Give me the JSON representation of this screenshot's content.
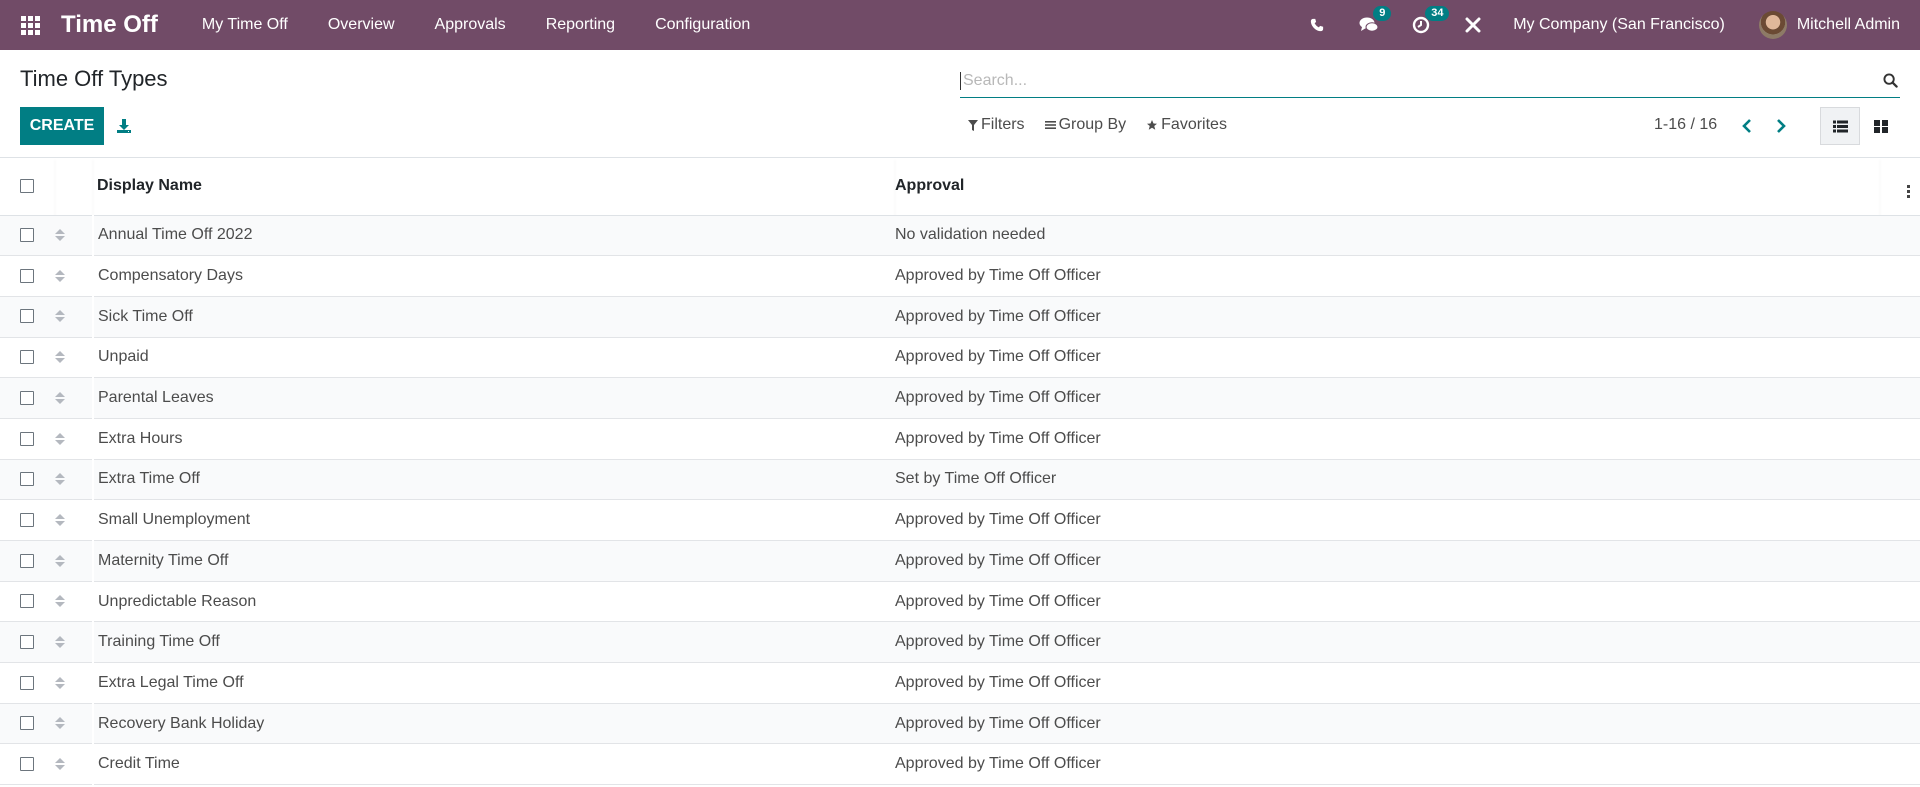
{
  "navbar": {
    "app_title": "Time Off",
    "menu": [
      {
        "label": "My Time Off"
      },
      {
        "label": "Overview"
      },
      {
        "label": "Approvals"
      },
      {
        "label": "Reporting"
      },
      {
        "label": "Configuration"
      }
    ],
    "icons": {
      "apps": "apps-grid-icon",
      "phone": "phone-icon",
      "messages": "chat-icon",
      "activities": "clock-icon",
      "debug": "tools-icon"
    },
    "messages_badge": "9",
    "activities_badge": "34",
    "company": "My Company (San Francisco)",
    "user_name": "Mitchell Admin"
  },
  "control_panel": {
    "title": "Time Off Types",
    "create_label": "CREATE",
    "search_placeholder": "Search...",
    "filters_label": "Filters",
    "group_by_label": "Group By",
    "favorites_label": "Favorites",
    "pager": "1-16 / 16",
    "active_view": "list"
  },
  "table": {
    "columns": [
      "Display Name",
      "Approval"
    ],
    "rows": [
      {
        "name": "Annual Time Off 2022",
        "approval": "No validation needed"
      },
      {
        "name": "Compensatory Days",
        "approval": "Approved by Time Off Officer"
      },
      {
        "name": "Sick Time Off",
        "approval": "Approved by Time Off Officer"
      },
      {
        "name": "Unpaid",
        "approval": "Approved by Time Off Officer"
      },
      {
        "name": "Parental Leaves",
        "approval": "Approved by Time Off Officer"
      },
      {
        "name": "Extra Hours",
        "approval": "Approved by Time Off Officer"
      },
      {
        "name": "Extra Time Off",
        "approval": "Set by Time Off Officer"
      },
      {
        "name": "Small Unemployment",
        "approval": "Approved by Time Off Officer"
      },
      {
        "name": "Maternity Time Off",
        "approval": "Approved by Time Off Officer"
      },
      {
        "name": "Unpredictable Reason",
        "approval": "Approved by Time Off Officer"
      },
      {
        "name": "Training Time Off",
        "approval": "Approved by Time Off Officer"
      },
      {
        "name": "Extra Legal Time Off",
        "approval": "Approved by Time Off Officer"
      },
      {
        "name": "Recovery Bank Holiday",
        "approval": "Approved by Time Off Officer"
      },
      {
        "name": "Credit Time",
        "approval": "Approved by Time Off Officer"
      }
    ]
  },
  "colors": {
    "brand": "#714b67",
    "primary": "#017e84"
  }
}
